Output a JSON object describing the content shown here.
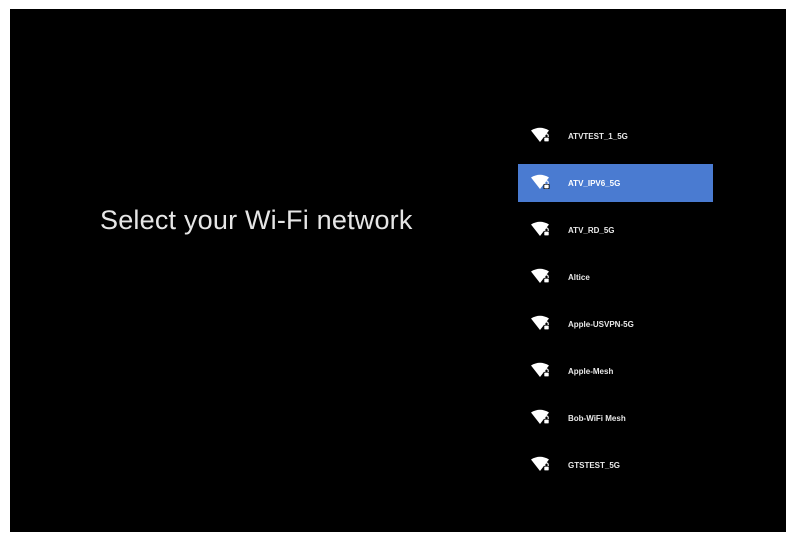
{
  "colors": {
    "background": "#000000",
    "text": "#e6e6e6",
    "selected_background": "#4a7bd1"
  },
  "title": "Select your Wi-Fi network",
  "networks": [
    {
      "name": "ATVTEST_1_5G",
      "icon": "wifi-lock-icon",
      "selected": false
    },
    {
      "name": "ATV_IPV6_5G",
      "icon": "wifi-lock-icon",
      "selected": true
    },
    {
      "name": "ATV_RD_5G",
      "icon": "wifi-lock-icon",
      "selected": false
    },
    {
      "name": "Altice",
      "icon": "wifi-lock-icon",
      "selected": false
    },
    {
      "name": "Apple-USVPN-5G",
      "icon": "wifi-lock-icon",
      "selected": false
    },
    {
      "name": "Apple-Mesh",
      "icon": "wifi-lock-icon",
      "selected": false
    },
    {
      "name": "Bob-WiFi Mesh",
      "icon": "wifi-lock-icon",
      "selected": false
    },
    {
      "name": "GTSTEST_5G",
      "icon": "wifi-lock-icon",
      "selected": false
    }
  ]
}
